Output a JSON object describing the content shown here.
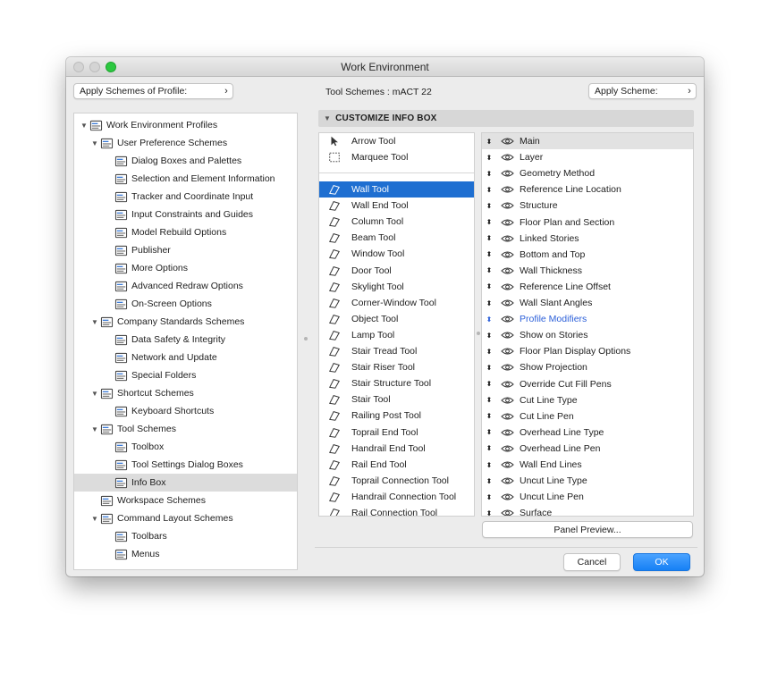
{
  "window": {
    "title": "Work Environment"
  },
  "toolbar": {
    "apply_profile_label": "Apply Schemes of Profile:",
    "tool_schemes_label": "Tool Schemes :  mACT 22",
    "apply_scheme_label": "Apply Scheme:"
  },
  "tree": [
    {
      "label": "Work Environment Profiles",
      "icon": "monitor-profile-icon",
      "level": 0,
      "expanded": true
    },
    {
      "label": "User Preference Schemes",
      "icon": "user-preference-icon",
      "level": 1,
      "expanded": true
    },
    {
      "label": "Dialog Boxes and Palettes",
      "icon": "dialog-boxes-icon",
      "level": 2
    },
    {
      "label": "Selection and Element Information",
      "icon": "selection-info-icon",
      "level": 2
    },
    {
      "label": "Tracker and Coordinate Input",
      "icon": "tracker-xyz-icon",
      "level": 2
    },
    {
      "label": "Input Constraints and Guides",
      "icon": "mouse-guides-icon",
      "level": 2
    },
    {
      "label": "Model Rebuild Options",
      "icon": "model-rebuild-icon",
      "level": 2
    },
    {
      "label": "Publisher",
      "icon": "publisher-icon",
      "level": 2
    },
    {
      "label": "More Options",
      "icon": "sliders-icon",
      "level": 2
    },
    {
      "label": "Advanced Redraw Options",
      "icon": "house-redraw-icon",
      "level": 2
    },
    {
      "label": "On-Screen Options",
      "icon": "on-screen-icon",
      "level": 2
    },
    {
      "label": "Company Standards Schemes",
      "icon": "company-standards-icon",
      "level": 1,
      "expanded": true
    },
    {
      "label": "Data Safety & Integrity",
      "icon": "data-safety-icon",
      "level": 2
    },
    {
      "label": "Network and Update",
      "icon": "globe-icon",
      "level": 2
    },
    {
      "label": "Special Folders",
      "icon": "folders-icon",
      "level": 2
    },
    {
      "label": "Shortcut Schemes",
      "icon": "shortcut-schemes-icon",
      "level": 1,
      "expanded": true
    },
    {
      "label": "Keyboard Shortcuts",
      "icon": "keyboard-shortcut-icon",
      "level": 2
    },
    {
      "label": "Tool Schemes",
      "icon": "tool-schemes-icon",
      "level": 1,
      "expanded": true
    },
    {
      "label": "Toolbox",
      "icon": "toolbox-icon",
      "level": 2
    },
    {
      "label": "Tool Settings Dialog Boxes",
      "icon": "tool-settings-icon",
      "level": 2
    },
    {
      "label": "Info Box",
      "icon": "info-box-icon",
      "level": 2,
      "selected": true
    },
    {
      "label": "Workspace Schemes",
      "icon": "workspace-icon",
      "level": 1
    },
    {
      "label": "Command Layout Schemes",
      "icon": "command-layout-icon",
      "level": 1,
      "expanded": true
    },
    {
      "label": "Toolbars",
      "icon": "toolbars-icon",
      "level": 2
    },
    {
      "label": "Menus",
      "icon": "menus-icon",
      "level": 2
    }
  ],
  "section": {
    "title": "CUSTOMIZE INFO BOX"
  },
  "tools_top": [
    {
      "label": "Arrow Tool",
      "icon": "arrow-tool-icon"
    },
    {
      "label": "Marquee Tool",
      "icon": "marquee-tool-icon"
    }
  ],
  "tools": [
    {
      "label": "Wall Tool",
      "icon": "wall-tool-icon",
      "selected": true
    },
    {
      "label": "Wall End Tool",
      "icon": "wall-end-tool-icon"
    },
    {
      "label": "Column Tool",
      "icon": "column-tool-icon"
    },
    {
      "label": "Beam Tool",
      "icon": "beam-tool-icon"
    },
    {
      "label": "Window Tool",
      "icon": "window-tool-icon"
    },
    {
      "label": "Door Tool",
      "icon": "door-tool-icon"
    },
    {
      "label": "Skylight Tool",
      "icon": "skylight-tool-icon"
    },
    {
      "label": "Corner-Window Tool",
      "icon": "corner-window-tool-icon"
    },
    {
      "label": "Object Tool",
      "icon": "object-tool-icon"
    },
    {
      "label": "Lamp Tool",
      "icon": "lamp-tool-icon"
    },
    {
      "label": "Stair Tread Tool",
      "icon": "stair-tread-tool-icon"
    },
    {
      "label": "Stair Riser Tool",
      "icon": "stair-riser-tool-icon"
    },
    {
      "label": "Stair Structure Tool",
      "icon": "stair-structure-tool-icon"
    },
    {
      "label": "Stair Tool",
      "icon": "stair-tool-icon"
    },
    {
      "label": "Railing Post Tool",
      "icon": "railing-post-tool-icon"
    },
    {
      "label": "Toprail End Tool",
      "icon": "toprail-end-tool-icon"
    },
    {
      "label": "Handrail End Tool",
      "icon": "handrail-end-tool-icon"
    },
    {
      "label": "Rail End Tool",
      "icon": "rail-end-tool-icon"
    },
    {
      "label": "Toprail Connection Tool",
      "icon": "toprail-connection-tool-icon"
    },
    {
      "label": "Handrail Connection Tool",
      "icon": "handrail-connection-tool-icon"
    },
    {
      "label": "Rail Connection Tool",
      "icon": "rail-connection-tool-icon"
    }
  ],
  "fields": [
    {
      "label": "Main",
      "selected": true
    },
    {
      "label": "Layer"
    },
    {
      "label": "Geometry Method"
    },
    {
      "label": "Reference Line Location"
    },
    {
      "label": "Structure"
    },
    {
      "label": "Floor Plan and Section"
    },
    {
      "label": "Linked Stories"
    },
    {
      "label": "Bottom and Top"
    },
    {
      "label": "Wall Thickness"
    },
    {
      "label": "Reference Line Offset"
    },
    {
      "label": "Wall Slant Angles"
    },
    {
      "label": "Profile Modifiers",
      "highlight": true
    },
    {
      "label": "Show on Stories"
    },
    {
      "label": "Floor Plan Display Options"
    },
    {
      "label": "Show Projection"
    },
    {
      "label": "Override Cut Fill Pens"
    },
    {
      "label": "Cut Line Type"
    },
    {
      "label": "Cut Line Pen"
    },
    {
      "label": "Overhead Line Type"
    },
    {
      "label": "Overhead Line Pen"
    },
    {
      "label": "Wall End Lines"
    },
    {
      "label": "Uncut Line Type"
    },
    {
      "label": "Uncut Line Pen"
    },
    {
      "label": "Surface"
    }
  ],
  "buttons": {
    "panel_preview": "Panel Preview...",
    "cancel": "Cancel",
    "ok": "OK"
  },
  "colors": {
    "accent": "#1f6fd1",
    "ok_button": "#1680f5",
    "highlight_text": "#2b5fd9"
  }
}
